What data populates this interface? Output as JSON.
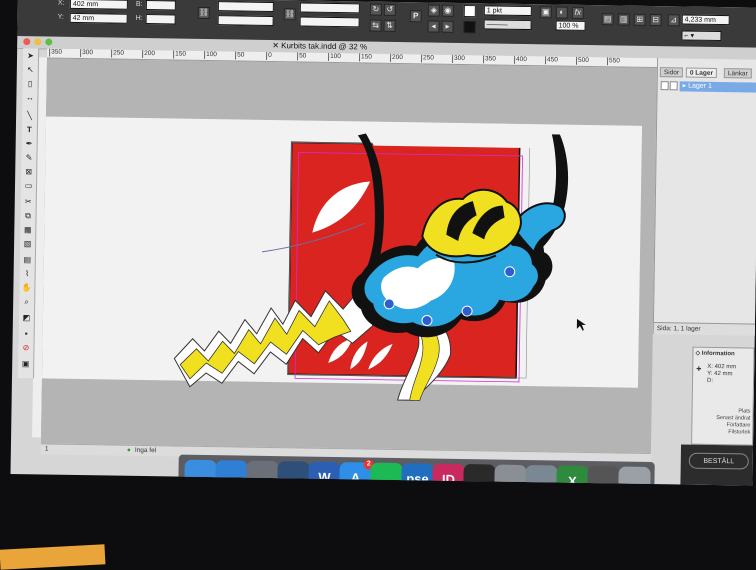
{
  "control_bar": {
    "x_value": "402 mm",
    "y_value": "42 mm",
    "x_label": "X:",
    "y_label": "Y:",
    "b_label": "B:",
    "h_label": "H:",
    "stroke_weight": "1 pkt",
    "scale_percent": "100 %",
    "measure": "4,233 mm",
    "p_glyph": "P",
    "fx_glyph": "fx"
  },
  "document": {
    "tab_title": "Kurbits tak.indd @ 32 %"
  },
  "ruler": {
    "ticks": [
      "350",
      "300",
      "250",
      "200",
      "150",
      "100",
      "50",
      "0",
      "50",
      "100",
      "150",
      "200",
      "250",
      "300",
      "350",
      "400",
      "450",
      "500",
      "550"
    ]
  },
  "layers_panel": {
    "tabs": [
      "Sidor",
      "Lager",
      "Länkar"
    ],
    "active_tab_prefix": "0",
    "layer_name": "Lager 1",
    "footer": "Sida: 1, 1 lager"
  },
  "info_panel": {
    "title": "Information",
    "x": "X: 402 mm",
    "y": "Y: 42 mm",
    "d": "D:",
    "meta": [
      "Plats",
      "Senast ändrat",
      "Författare",
      "Filstorlek"
    ]
  },
  "save_button": "BESTÄLL",
  "status_bar": {
    "page": "1",
    "preflight": "Inga fel"
  },
  "dock": {
    "badge": "2",
    "apps": [
      {
        "name": "finder-icon",
        "label": "",
        "color": "#3b8de0"
      },
      {
        "name": "safari-icon",
        "label": "",
        "color": "#2f7fd4"
      },
      {
        "name": "launchpad-icon",
        "label": "",
        "color": "#6a6f78"
      },
      {
        "name": "book-icon",
        "label": "",
        "color": "#2d4f7a"
      },
      {
        "name": "word-icon",
        "label": "W",
        "color": "#2b5fb4"
      },
      {
        "name": "app-store-icon",
        "label": "A",
        "color": "#2f8fe8"
      },
      {
        "name": "spotify-icon",
        "label": "",
        "color": "#1db954"
      },
      {
        "name": "photoshop-elements-icon",
        "label": "pse",
        "color": "#1f6ec0"
      },
      {
        "name": "indesign-icon",
        "label": "ID",
        "color": "#c8295f"
      },
      {
        "name": "imovie-icon",
        "label": "",
        "color": "#2a2a2a"
      },
      {
        "name": "image-capture-icon",
        "label": "",
        "color": "#8a8f96"
      },
      {
        "name": "preview-icon",
        "label": "",
        "color": "#7a8894"
      },
      {
        "name": "excel-icon",
        "label": "X",
        "color": "#2e8b3d"
      },
      {
        "name": "installer-icon",
        "label": "",
        "color": "#555"
      },
      {
        "name": "trash-icon",
        "label": "",
        "color": "#9aa0a6"
      }
    ]
  },
  "colors": {
    "red": "#d9241f",
    "yellow": "#f0e020",
    "blue": "#2aa6e0",
    "black": "#111111"
  }
}
